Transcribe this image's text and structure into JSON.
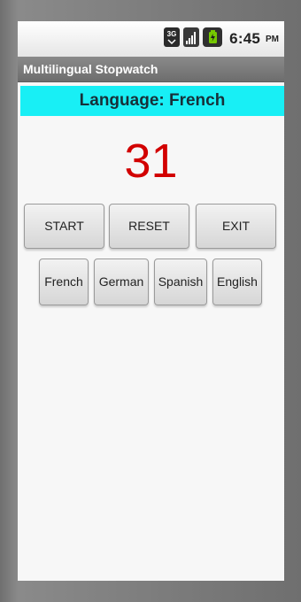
{
  "status_bar": {
    "network_label": "3G",
    "time": "6:45",
    "ampm": "PM",
    "icons": [
      "network-3g-icon",
      "signal-strength-icon",
      "battery-icon"
    ]
  },
  "app": {
    "title": "Multilingual Stopwatch"
  },
  "language_banner": {
    "text": "Language: French",
    "background_color": "#18eff5"
  },
  "counter": {
    "value": "31",
    "color": "#d20000"
  },
  "controls": {
    "start_label": "START",
    "reset_label": "RESET",
    "exit_label": "EXIT"
  },
  "languages": {
    "french": "French",
    "german": "German",
    "spanish": "Spanish",
    "english": "English"
  }
}
